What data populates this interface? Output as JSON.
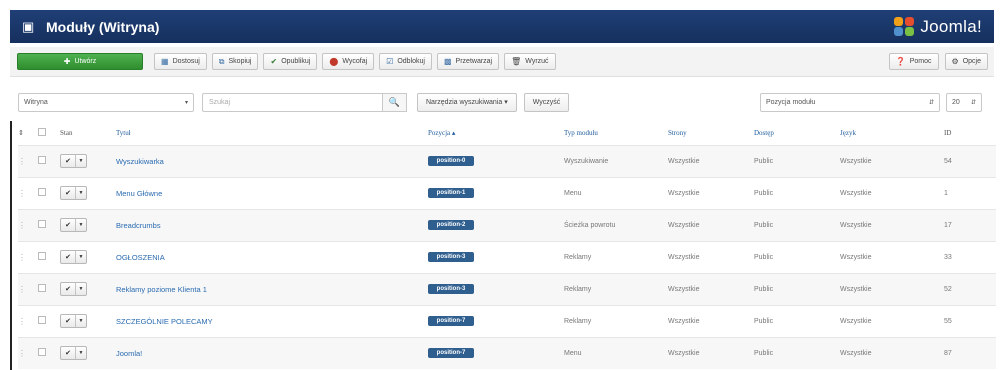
{
  "header": {
    "title": "Moduły (Witryna)",
    "logo_text": "Joomla!"
  },
  "toolbar": {
    "new": "Utwórz",
    "edit": "Dostosuj",
    "copy": "Skopiuj",
    "publish": "Opublikuj",
    "unpublish": "Wycofaj",
    "checkin": "Odblokuj",
    "batch": "Przetwarzaj",
    "trash": "Wyrzuć",
    "help": "Pomoc",
    "options": "Opcje"
  },
  "filters": {
    "client": "Witryna",
    "search_placeholder": "Szukaj",
    "tools": "Narzędzia wyszukiwania ▾",
    "clear": "Wyczyść",
    "position": "Pozycja modułu",
    "limit": "20"
  },
  "columns": {
    "state": "Stan",
    "title": "Tytuł",
    "position": "Pozycja ▴",
    "type": "Typ modułu",
    "pages": "Strony",
    "access": "Dostęp",
    "language": "Język",
    "id": "ID"
  },
  "rows": [
    {
      "title": "Wyszukiwarka",
      "position": "position-0",
      "type": "Wyszukiwanie",
      "pages": "Wszystkie",
      "access": "Public",
      "language": "Wszystkie",
      "id": "54"
    },
    {
      "title": "Menu Główne",
      "position": "position-1",
      "type": "Menu",
      "pages": "Wszystkie",
      "access": "Public",
      "language": "Wszystkie",
      "id": "1"
    },
    {
      "title": "Breadcrumbs",
      "position": "position-2",
      "type": "Ścieżka powrotu",
      "pages": "Wszystkie",
      "access": "Public",
      "language": "Wszystkie",
      "id": "17"
    },
    {
      "title": "OGŁOSZENIA",
      "position": "position-3",
      "type": "Reklamy",
      "pages": "Wszystkie",
      "access": "Public",
      "language": "Wszystkie",
      "id": "33"
    },
    {
      "title": "Reklamy poziome Klienta 1",
      "position": "position-3",
      "type": "Reklamy",
      "pages": "Wszystkie",
      "access": "Public",
      "language": "Wszystkie",
      "id": "52"
    },
    {
      "title": "SZCZEGÓLNIE POLECAMY",
      "position": "position-7",
      "type": "Reklamy",
      "pages": "Wszystkie",
      "access": "Public",
      "language": "Wszystkie",
      "id": "55"
    },
    {
      "title": "Joomla!",
      "position": "position-7",
      "type": "Menu",
      "pages": "Wszystkie",
      "access": "Public",
      "language": "Wszystkie",
      "id": "87"
    }
  ]
}
